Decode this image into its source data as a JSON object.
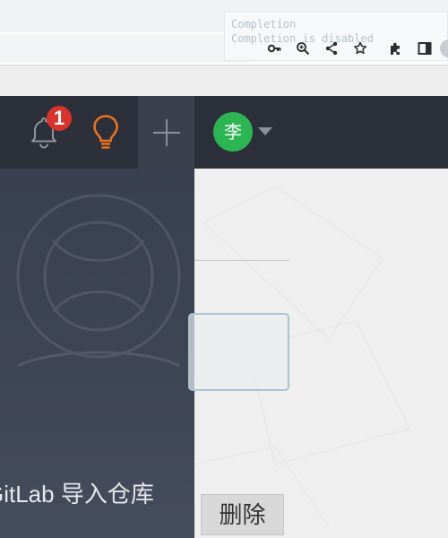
{
  "tooltip": {
    "title": "Completion",
    "message": "Completion is disabled"
  },
  "browser_icons": [
    "key-icon",
    "zoom-icon",
    "share-icon",
    "bookmark-star-icon",
    "extensions-icon",
    "side-panel-icon"
  ],
  "header": {
    "notifications_count": "1",
    "user_avatar_char": "李"
  },
  "sidebar": {
    "item_label": "GitLab 导入仓库"
  },
  "main": {
    "delete_label": "删除"
  },
  "colors": {
    "header_bg": "#2b303b",
    "sidebar_bg": "#3e4555",
    "badge": "#d9332c",
    "bulb": "#e8731c",
    "avatar": "#2cb653"
  }
}
